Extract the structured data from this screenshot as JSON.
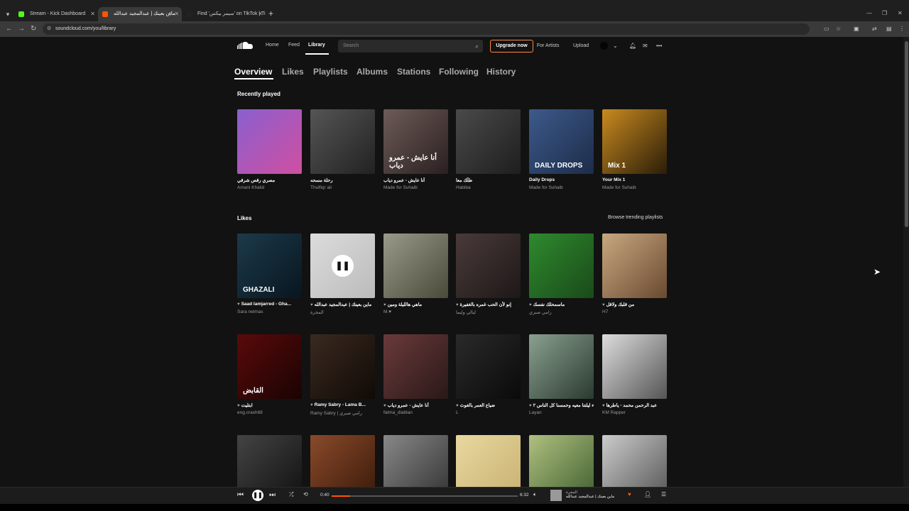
{
  "browser": {
    "tabs": [
      {
        "title": "Stream - Kick Dashboard",
        "color": "#53fc18",
        "active": false
      },
      {
        "title": "ماين بعينك | عبدالمجيد عبدالله",
        "color": "#f50",
        "active": true,
        "audio": true
      },
      {
        "title": "Find 'سيمر بيكس' on TikTok | Ti",
        "color": "#222",
        "active": false
      }
    ],
    "url": "soundcloud.com/you/library"
  },
  "header": {
    "nav": [
      "Home",
      "Feed",
      "Library"
    ],
    "search_placeholder": "Search",
    "upgrade": "Upgrade now",
    "for_artists": "For Artists",
    "upload": "Upload"
  },
  "library_tabs": [
    "Overview",
    "Likes",
    "Playlists",
    "Albums",
    "Stations",
    "Following",
    "History"
  ],
  "recently_played": {
    "title": "Recently played",
    "items": [
      {
        "title": "مصري رقص شرقي",
        "sub": "Amani Khalid",
        "color": "#8a5fd0",
        "color2": "#d04fa0"
      },
      {
        "title": "رحلة مسحه",
        "sub": "Thulfiqr ali",
        "color": "#555",
        "color2": "#222"
      },
      {
        "title": "أنا عايش - عمرو دياب",
        "sub": "Made for Suhaib",
        "color": "#6d5b58",
        "color2": "#2a2020",
        "overlay": "أنا عايش - عمرو دياب"
      },
      {
        "title": "طلّك معا",
        "sub": "Habiba",
        "color": "#4a4a4a",
        "color2": "#1e1e1e"
      },
      {
        "title": "Daily Drops",
        "sub": "Made for Suhaib",
        "color": "#3c5a8a",
        "color2": "#1d2c4a",
        "overlay": "DAILY DROPS"
      },
      {
        "title": "Your Mix 1",
        "sub": "Made for Suhaib",
        "color": "#c98a20",
        "color2": "#2a1d08",
        "overlay": "Mix 1"
      }
    ]
  },
  "likes": {
    "title": "Likes",
    "browse": "Browse trending playlists",
    "rows": [
      [
        {
          "title": "Saad lamjarred - Gha...",
          "sub": "Sara nelmas",
          "color": "#1c3a4a",
          "color2": "#081620",
          "overlay": "GHAZALI"
        },
        {
          "title": "ماين بعينك | عبدالمجيد عبدالله",
          "sub": "المجرة",
          "color": "#dcdcdc",
          "color2": "#bbb",
          "playing": true
        },
        {
          "title": "ماهي هالليلة ومين",
          "sub": "M.♥",
          "color": "#9a9a8a",
          "color2": "#4a4a3a"
        },
        {
          "title": "إنو لأن الحب غمره بالغفيرة",
          "sub": "ليالي وليما",
          "color": "#4a3a3a",
          "color2": "#1e1818"
        },
        {
          "title": "ماسمحلك نفسك",
          "sub": "رامي صبري",
          "color": "#2e8a2e",
          "color2": "#1a4a1a"
        },
        {
          "title": "من قلبك ولاقل",
          "sub": "H7",
          "color": "#c8a880",
          "color2": "#6a4a30"
        }
      ],
      [
        {
          "title": "ابتليت",
          "sub": "eng.crash88",
          "color": "#5a0a0a",
          "color2": "#1a0303",
          "overlay": "القابض"
        },
        {
          "title": "Ramy Sabry - Lama B...",
          "sub": "Ramy Sabry | رامي صبري",
          "color": "#3a2a20",
          "color2": "#100a06"
        },
        {
          "title": "أنا عايش - عمرو دياب",
          "sub": "fatma_diablan",
          "color": "#6a3a3a",
          "color2": "#2a1818"
        },
        {
          "title": "ضياع العمر بالغوث",
          "sub": "L",
          "color": "#2a2a2a",
          "color2": "#0a0a0a"
        },
        {
          "title": "لو لقاء ليلتنا معيه وحمسنا كل الناس ٢",
          "sub": "Layan",
          "color": "#8aa090",
          "color2": "#2a3a30"
        },
        {
          "title": "عبد الرحمن محمد - ياطرها",
          "sub": "KM Rapper",
          "color": "#ddd",
          "color2": "#555"
        }
      ],
      [
        {
          "title": "",
          "sub": "",
          "color": "#444",
          "color2": "#111"
        },
        {
          "title": "",
          "sub": "",
          "color": "#8a4a2a",
          "color2": "#3a1a0a"
        },
        {
          "title": "",
          "sub": "",
          "color": "#888",
          "color2": "#333"
        },
        {
          "title": "",
          "sub": "",
          "color": "#e8d8a0",
          "color2": "#c8b070"
        },
        {
          "title": "",
          "sub": "",
          "color": "#b0c080",
          "color2": "#406030"
        },
        {
          "title": "",
          "sub": "",
          "color": "#ccc",
          "color2": "#555"
        }
      ]
    ]
  },
  "player": {
    "elapsed": "0:40",
    "duration": "6:32",
    "progress": 0.1,
    "track_artist": "المجرة",
    "track_title": "ماين بعينك | عبدالمجيد عبدالله"
  }
}
